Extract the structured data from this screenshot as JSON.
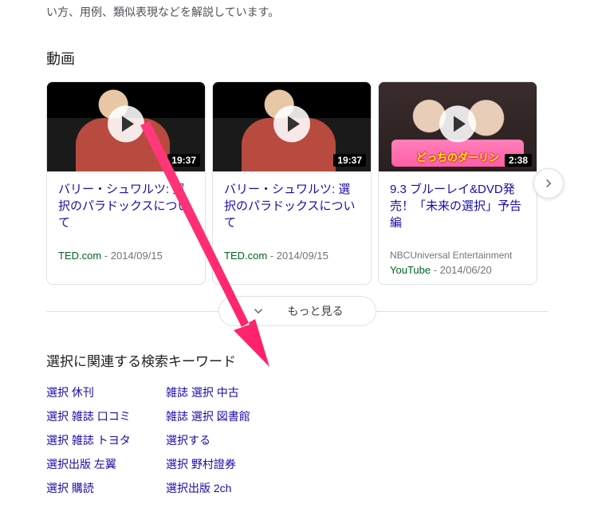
{
  "snippet_fragment": "い方、用例、類似表現などを解説しています。",
  "video_section_heading": "動画",
  "videos": [
    {
      "title": "バリー・シュワルツ: 選択のパラドックスについて",
      "duration": "19:37",
      "source": "TED.com",
      "date": "2014/09/15",
      "channel": "",
      "thumb_style": "ted"
    },
    {
      "title": "バリー・シュワルツ: 選択のパラドックスについて",
      "duration": "19:37",
      "source": "TED.com",
      "date": "2014/09/15",
      "channel": "",
      "thumb_style": "ted"
    },
    {
      "title": "9.3 ブルーレイ&DVD発売！「未来の選択」予告編",
      "duration": "2:38",
      "source": "YouTube",
      "date": "2014/06/20",
      "channel": "NBCUniversal Entertainment",
      "thumb_style": "drama",
      "thumb_caption": "どっちのダーリン"
    }
  ],
  "more_button_label": "もっと見る",
  "related_heading": "選択に関連する検索キーワード",
  "related_col1": [
    "選択 休刊",
    "選択 雑誌 口コミ",
    "選択 雑誌 トヨタ",
    "選択出版 左翼",
    "選択 購読"
  ],
  "related_col2": [
    "雑誌 選択 中古",
    "雑誌 選択 図書館",
    "選択する",
    "選択 野村證券",
    "選択出版 2ch"
  ],
  "annotation_arrow_color": "#ff3b7b"
}
